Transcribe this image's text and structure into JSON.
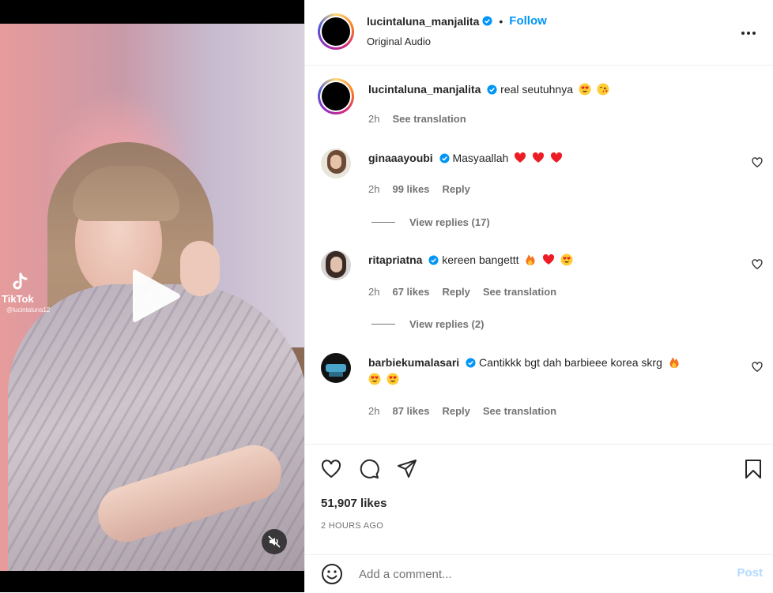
{
  "media": {
    "watermark_brand": "TikTok",
    "watermark_user": "@lucintaluna12"
  },
  "header": {
    "username": "lucintaluna_manjalita",
    "separator": "•",
    "follow_label": "Follow",
    "audio_label": "Original Audio"
  },
  "comments": [
    {
      "username": "lucintaluna_manjalita",
      "text": "real seutuhnya",
      "emojis": [
        "heart-eyes",
        "kiss-face"
      ],
      "time": "2h",
      "meta": [
        "See translation"
      ],
      "is_caption": true
    },
    {
      "username": "ginaaayoubi",
      "text": "Masyaallah",
      "emojis": [
        "red-heart",
        "red-heart",
        "red-heart"
      ],
      "time": "2h",
      "likes": "99 likes",
      "reply": "Reply",
      "view_replies": "View replies (17)"
    },
    {
      "username": "ritapriatna",
      "text": "kereen bangettt",
      "emojis": [
        "fire",
        "red-heart",
        "heart-eyes"
      ],
      "time": "2h",
      "likes": "67 likes",
      "reply": "Reply",
      "translation": "See translation",
      "view_replies": "View replies (2)"
    },
    {
      "username": "barbiekumalasari",
      "text": "Cantikkk bgt dah barbieee korea skrg",
      "emojis": [
        "fire",
        "heart-eyes",
        "heart-eyes"
      ],
      "time": "2h",
      "likes": "87 likes",
      "reply": "Reply",
      "translation": "See translation"
    }
  ],
  "actions": {
    "likes": "51,907 likes",
    "time": "2 HOURS AGO"
  },
  "composer": {
    "placeholder": "Add a comment...",
    "post_label": "Post"
  },
  "colors": {
    "accent": "#0095f6",
    "post_disabled": "#b3dbff",
    "secondary_text": "#737373",
    "verified": "#0095f6",
    "heart_red": "#ed1c24"
  }
}
